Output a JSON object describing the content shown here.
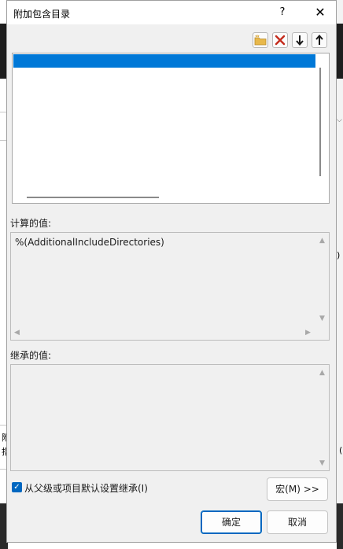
{
  "dialog": {
    "title": "附加包含目录",
    "help_label": "?",
    "close_label": "✕"
  },
  "toolbar": {
    "icons": [
      "new-folder-icon",
      "delete-icon",
      "move-down-icon",
      "move-up-icon"
    ],
    "delete_color": "#c42b1c",
    "folder_color": "#e8b84a"
  },
  "list": {
    "selected_color": "#0078d7",
    "items": [
      ""
    ]
  },
  "evaluated": {
    "label": "计算的值:",
    "value": "%(AdditionalIncludeDirectories)"
  },
  "inherited": {
    "label": "继承的值:",
    "value": ""
  },
  "inherit_checkbox": {
    "checked": true,
    "label": "从父级或项目默认设置继承(I)"
  },
  "buttons": {
    "macros": "宏(M) >>",
    "ok": "确定",
    "cancel": "取消"
  },
  "background": {
    "side_text_1": "附",
    "side_text_2": "指",
    "paren_1": ")",
    "paren_2": "("
  },
  "accent_color": "#0067c0"
}
